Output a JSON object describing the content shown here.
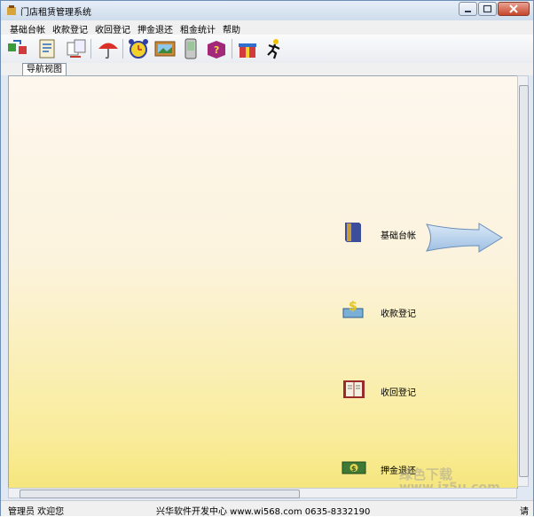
{
  "window": {
    "title": "门店租赁管理系统"
  },
  "menu": [
    "基础台帐",
    "收款登记",
    "收回登记",
    "押金退还",
    "租金统计",
    "帮助"
  ],
  "toolbar": {
    "buttons": [
      "exchange-icon",
      "document-icon",
      "transfer-icon",
      "umbrella-icon",
      "alarm-clock-icon",
      "picture-icon",
      "handheld-icon",
      "help-book-icon",
      "gift-icon",
      "exit-runner-icon"
    ]
  },
  "tab": {
    "label": "导航视图"
  },
  "nav": {
    "items": [
      {
        "label": "基础台帐",
        "icon": "ledger-book-icon"
      },
      {
        "label": "收款登记",
        "icon": "money-icon"
      },
      {
        "label": "收回登记",
        "icon": "open-book-icon"
      },
      {
        "label": "押金退还",
        "icon": "cash-icon"
      }
    ]
  },
  "status": {
    "left": "管理员 欢迎您",
    "middle": "兴华软件开发中心 www.wi568.com 0635-8332190",
    "right": "请"
  },
  "watermark": {
    "text1": "绿色下载",
    "text2": "www.jz5u.com"
  }
}
